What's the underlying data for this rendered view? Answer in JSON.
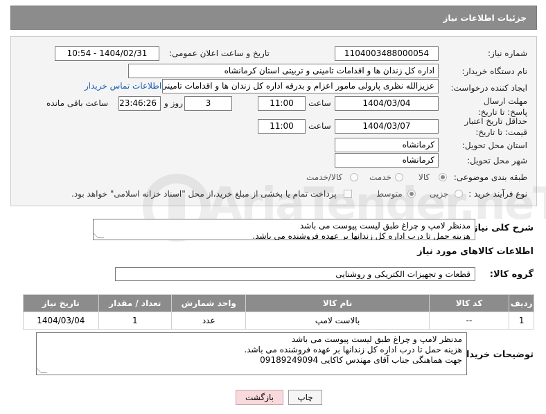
{
  "header": {
    "title": "جزئیات اطلاعات نیاز"
  },
  "fields": {
    "need_number_label": "شماره نیاز:",
    "need_number": "1104003488000054",
    "announce_label": "تاریخ و ساعت اعلان عمومی:",
    "announce_value": "1404/02/31 - 10:54",
    "buyer_org_label": "نام دستگاه خریدار:",
    "buyer_org": "اداره کل زندان ها و اقدامات تامینی و تربیتی استان کرمانشاه",
    "requester_label": "ایجاد کننده درخواست:",
    "requester": "عزیزالله نظری پارولی مامور اعزام و بدرقه اداره کل زندان ها و اقدامات تامینی و تربیتی",
    "contact_link": "اطلاعات تماس خریدار",
    "deadline_label": "مهلت ارسال پاسخ: تا تاریخ:",
    "deadline_date": "1404/03/04",
    "time_label": "ساعت",
    "deadline_time": "11:00",
    "days_value": "3",
    "days_label": "روز و",
    "remaining_value": "23:46:26",
    "remaining_label": "ساعت باقی مانده",
    "validity_label": "حداقل تاریخ اعتبار قیمت: تا تاریخ:",
    "validity_date": "1404/03/07",
    "validity_time": "11:00",
    "province_label": "استان محل تحویل:",
    "province": "کرمانشاه",
    "city_label": "شهر محل تحویل:",
    "city": "کرمانشاه",
    "category_label": "طبقه بندی موضوعی:",
    "category_options": [
      "کالا",
      "خدمت",
      "کالا/خدمت"
    ],
    "process_label": "نوع فرآیند خرید :",
    "process_options": [
      "جزیی",
      "متوسط"
    ],
    "payment_note": "پرداخت تمام یا بخشی از مبلغ خرید،از محل \"اسناد خزانه اسلامی\" خواهد بود."
  },
  "description": {
    "label": "شرح کلی نیاز:",
    "line1": "مدنظر لامپ و چراغ طبق لیست پیوست می باشد",
    "line2": "هزینه حمل تا درب اداره کل زندانها بر عهده فروشنده می باشد."
  },
  "goods": {
    "section_title": "اطلاعات کالاهای مورد نیاز",
    "group_label": "گروه کالا:",
    "group_value": "قطعات و تجهیزات الکتریکی و روشنایی",
    "columns": [
      "ردیف",
      "کد کالا",
      "نام کالا",
      "واحد شمارش",
      "تعداد / مقدار",
      "تاریخ نیاز"
    ],
    "rows": [
      [
        "1",
        "--",
        "بالاست لامپ",
        "عدد",
        "1",
        "1404/03/04"
      ]
    ]
  },
  "buyer_notes": {
    "label": "توضیحات خریدار:",
    "line1": "مدنظر لامپ و چراغ طبق لیست پیوست می باشد",
    "line2": "هزینه حمل تا درب اداره کل زندانها بر عهده فروشنده می باشد.",
    "line3": "جهت هماهنگی جناب آقای مهندس کاکایی 09189249094"
  },
  "buttons": {
    "print": "چاپ",
    "back": "بازگشت"
  },
  "watermark": "AriaTender.neT"
}
